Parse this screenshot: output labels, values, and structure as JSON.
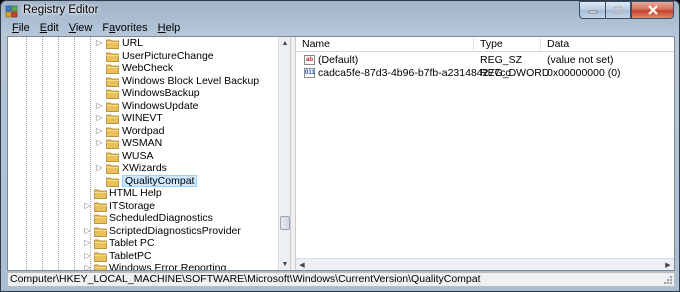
{
  "window": {
    "title": "Registry Editor"
  },
  "menu": [
    {
      "pre": "",
      "key": "F",
      "post": "ile"
    },
    {
      "pre": "",
      "key": "E",
      "post": "dit"
    },
    {
      "pre": "",
      "key": "V",
      "post": "iew"
    },
    {
      "pre": "F",
      "key": "a",
      "post": "vorites"
    },
    {
      "pre": "",
      "key": "H",
      "post": "elp"
    }
  ],
  "tree": {
    "items": [
      {
        "label": "URL",
        "expander": "▷"
      },
      {
        "label": "UserPictureChange",
        "expander": ""
      },
      {
        "label": "WebCheck",
        "expander": ""
      },
      {
        "label": "Windows Block Level Backup",
        "expander": ""
      },
      {
        "label": "WindowsBackup",
        "expander": ""
      },
      {
        "label": "WindowsUpdate",
        "expander": "▷"
      },
      {
        "label": "WINEVT",
        "expander": "▷"
      },
      {
        "label": "Wordpad",
        "expander": "▷"
      },
      {
        "label": "WSMAN",
        "expander": "▷"
      },
      {
        "label": "WUSA",
        "expander": ""
      },
      {
        "label": "XWizards",
        "expander": "▷"
      },
      {
        "label": "QualityCompat",
        "expander": "",
        "selected": true
      },
      {
        "label": "HTML Help",
        "expander": ""
      },
      {
        "label": "ITStorage",
        "expander": "▷"
      },
      {
        "label": "ScheduledDiagnostics",
        "expander": ""
      },
      {
        "label": "ScriptedDiagnosticsProvider",
        "expander": "▷"
      },
      {
        "label": "Tablet PC",
        "expander": "▷"
      },
      {
        "label": "TabletPC",
        "expander": "▷"
      },
      {
        "label": "Windows Error Reporting",
        "expander": "▷"
      }
    ]
  },
  "list": {
    "columns": [
      "Name",
      "Type",
      "Data"
    ],
    "rows": [
      {
        "icon": "ab",
        "name": "(Default)",
        "type": "REG_SZ",
        "data": "(value not set)"
      },
      {
        "icon": "011",
        "name": "cadca5fe-87d3-4b96-b7fb-a231484277cc",
        "type": "REG_DWORD",
        "data": "0x00000000 (0)"
      }
    ]
  },
  "status": {
    "path": "Computer\\HKEY_LOCAL_MACHINE\\SOFTWARE\\Microsoft\\Windows\\CurrentVersion\\QualityCompat"
  },
  "icons": {
    "app": "registry-icon",
    "folder": "folder-icon",
    "string_value": "string-value-icon",
    "binary_value": "dword-value-icon"
  },
  "colors": {
    "selection_bg": "#cde8ff",
    "folder": "#e8c15a",
    "close_button": "#c7402a"
  }
}
